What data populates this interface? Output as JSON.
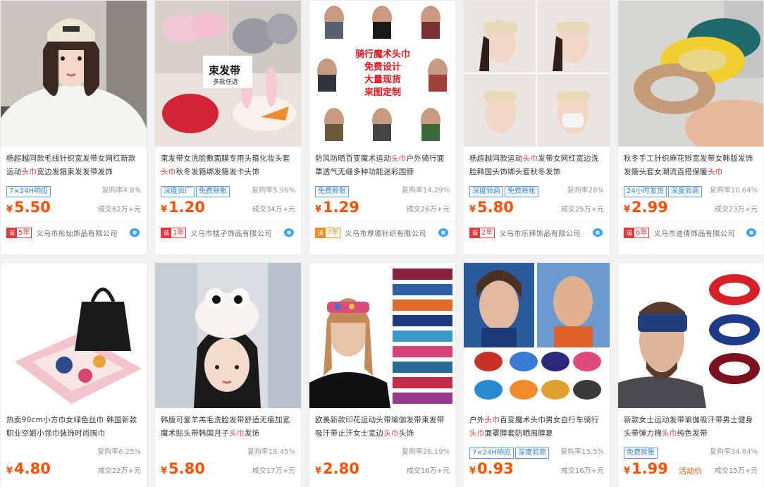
{
  "products": [
    {
      "title_pre": "杨超越同款毛线针织宽发带女网红新款运动",
      "title_hl": "头巾",
      "title_post": "宽边发箍束发发带发饰",
      "tags": [
        "7×24H响应"
      ],
      "repurchase": "复购率4.8%",
      "price": "5.50",
      "sold": "成交62万+元",
      "years": "5年",
      "shop": "义乌市彤灿饰品有限公司"
    },
    {
      "title_pre": "束发带女洗脸敷面膜专用头箍化妆头套",
      "title_hl": "头巾",
      "title_post": "秋冬发箍绑发箍发卡头饰",
      "tags": [
        "深度验厂",
        "免费赊账"
      ],
      "repurchase": "复购率5.96%",
      "price": "1.20",
      "sold": "成交34万+元",
      "years": "1年",
      "shop": "义乌市桔子饰品有限公司",
      "overlay_title": "束发带",
      "overlay_sub": "多款任选"
    },
    {
      "title_pre": "防风防晒百变魔术运动",
      "title_hl": "头巾",
      "title_post": "户外骑行面罩透气无缝多种功能迷彩围脖",
      "tags": [
        "免费赊账"
      ],
      "repurchase": "复购率14.29%",
      "price": "1.29",
      "sold": "成交26万+元",
      "years": "7年",
      "shop": "义乌市厚德针织有限公司",
      "overlay_lines": [
        "骑行魔术头巾",
        "免费设计",
        "大量现货",
        "来图定制"
      ]
    },
    {
      "title_pre": "杨超越同款运动",
      "title_hl": "头巾",
      "title_post": "发带女网红宽边洗脸韩国头饰绑头套秋冬发饰",
      "tags": [
        "深度验商",
        "免费赊账"
      ],
      "repurchase": "复购率28%",
      "price": "5.80",
      "sold": "成交25万+元",
      "years": "2年",
      "shop": "义乌市乐拜饰品有限公司"
    },
    {
      "title_pre": "秋冬手工针织麻花辫宽发带女韩版发饰发箍头套女潮流百搭保暖",
      "title_hl": "头巾",
      "title_post": "",
      "tags": [
        "24小时发货",
        "深度验商"
      ],
      "repurchase": "复购率10.64%",
      "price": "2.99",
      "sold": "成交23万+元",
      "years": "6年",
      "shop": "义乌市迪倩饰品有限公司"
    },
    {
      "title_pre": "热卖90cm小方巾女绿色丝巾 韩国新款职业空姐小领巾装饰时尚围巾",
      "title_hl": "",
      "title_post": "",
      "tags": [],
      "repurchase": "复购率6.25%",
      "price": "4.80",
      "sold": "成交22万+元"
    },
    {
      "title_pre": "韩版可爱羊羔毛洗脸发带舒适无痕加宽魔术贴头带韩国月子",
      "title_hl": "头巾",
      "title_post": "发饰",
      "tags": [],
      "repurchase": "复购率18.45%",
      "price": "5.80",
      "sold": "成交17万+元"
    },
    {
      "title_pre": "欧美新款印花运动头带瑜伽发带束发带吸汗带止汗女士宽边",
      "title_hl": "头巾",
      "title_post": "头饰",
      "tags": [],
      "repurchase": "复购率26.19%",
      "price": "2.80",
      "sold": "成交16万+元"
    },
    {
      "title_pre": "户外",
      "title_hl": "头巾",
      "title_post": "百变魔术头巾男女自行车骑行",
      "title_pre2": "头巾",
      "title_post2": "面罩脖套防晒围脖夏",
      "tags": [
        "7×24H响应",
        "深度验商"
      ],
      "repurchase": "复购率15.5%",
      "price": "0.93",
      "sold": "成交16万+元"
    },
    {
      "title_pre": "新款女士运动发带瑜伽吸汗带男士健身头带弹力棉",
      "title_hl": "头巾",
      "title_post": "纯色发带",
      "tags": [
        "免费赊账"
      ],
      "repurchase": "复购率34.84%",
      "price": "1.99",
      "sold": "成交15万+元",
      "promo": "活动价"
    }
  ],
  "currency": "¥",
  "badge_icon": "诚",
  "colors": {
    "price": "#ff5000",
    "keyword": "#e4393c",
    "tag": "#2f7fd6"
  }
}
